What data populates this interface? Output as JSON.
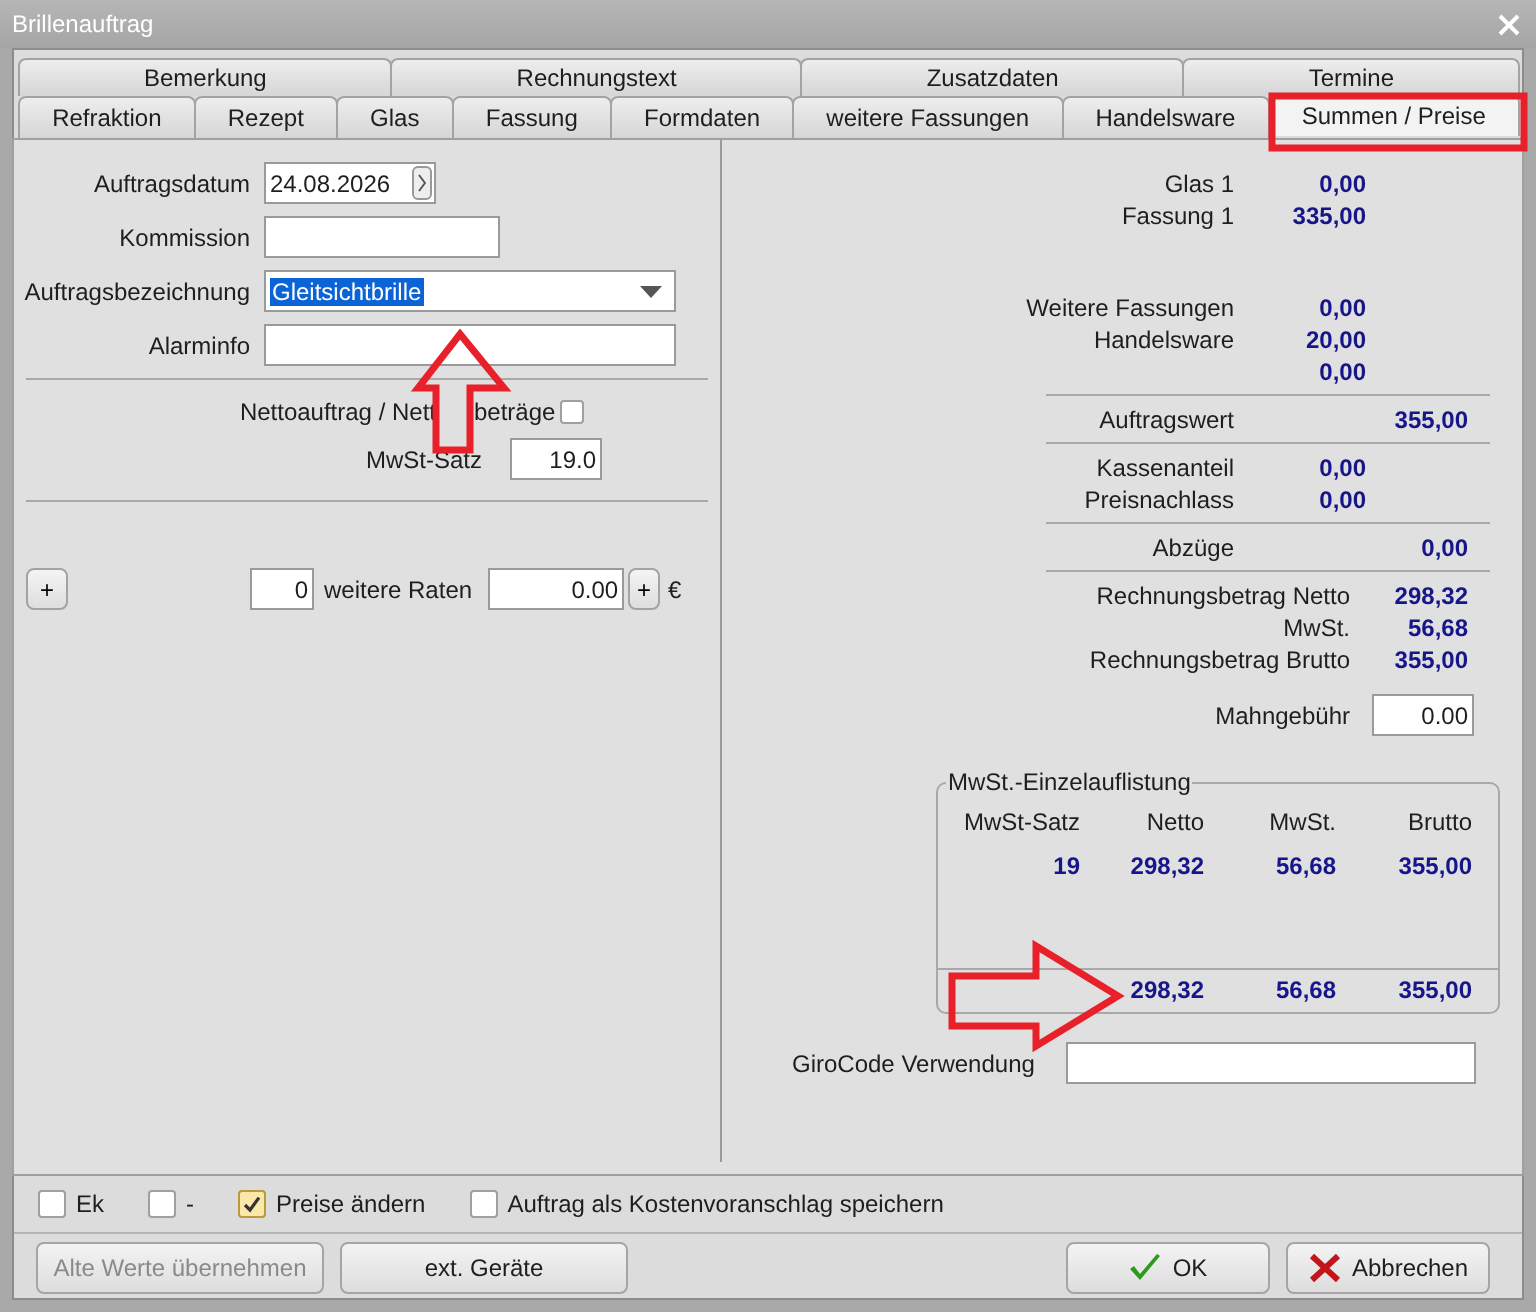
{
  "window": {
    "title": "Brillenauftrag"
  },
  "tabs": {
    "upper": [
      {
        "label": "Bemerkung",
        "selected": false
      },
      {
        "label": "Rechnungstext",
        "selected": false
      },
      {
        "label": "Zusatzdaten",
        "selected": false
      },
      {
        "label": "Termine",
        "selected": false
      }
    ],
    "lower": [
      {
        "label": "Refraktion",
        "selected": false
      },
      {
        "label": "Rezept",
        "selected": false
      },
      {
        "label": "Glas",
        "selected": false
      },
      {
        "label": "Fassung",
        "selected": false
      },
      {
        "label": "Formdaten",
        "selected": false
      },
      {
        "label": "weitere Fassungen",
        "selected": false
      },
      {
        "label": "Handelsware",
        "selected": false
      },
      {
        "label": "Summen / Preise",
        "selected": true
      }
    ]
  },
  "order": {
    "fields": [
      {
        "kind": "date",
        "label": "Auftragsdatum",
        "value": "24.08.2026"
      },
      {
        "kind": "short_text",
        "label": "Kommission"
      },
      {
        "kind": "combo",
        "label": "Auftragsbezeichnung",
        "value": "Gleitsichtbrille",
        "selected": true
      },
      {
        "kind": "text",
        "label": "Alarminfo"
      }
    ],
    "net_order": {
      "label_parts": [
        "Nettoauftrag / Nett",
        "beträge"
      ],
      "checked": false
    },
    "vat_rate": {
      "label": "MwSt-Satz",
      "value": "19.0"
    },
    "installments": {
      "add_button": "+",
      "count": "0",
      "label": "weitere Raten",
      "amount": "0.00",
      "amount_button": "+",
      "currency": "€"
    }
  },
  "summary": {
    "sections": [
      {
        "rows": [
          {
            "kind": "item",
            "label": "Glas 1",
            "value": "0,00"
          },
          {
            "kind": "item",
            "label": "Fassung 1",
            "value": "335,00"
          }
        ]
      },
      {
        "rows": [
          {
            "kind": "item",
            "label": "Weitere Fassungen",
            "value": "0,00"
          },
          {
            "kind": "item",
            "label": "Handelsware",
            "value": "20,00"
          },
          {
            "kind": "item",
            "value": "0,00"
          }
        ]
      },
      {
        "rows": [
          {
            "kind": "total",
            "label": "Auftragswert",
            "value": "355,00"
          }
        ]
      },
      {
        "rows": [
          {
            "kind": "item",
            "label": "Kassenanteil",
            "value": "0,00"
          },
          {
            "kind": "item",
            "label": "Preisnachlass",
            "value": "0,00"
          }
        ]
      },
      {
        "rows": [
          {
            "kind": "total",
            "label": "Abzüge",
            "value": "0,00"
          }
        ]
      },
      {
        "rows": [
          {
            "kind": "result",
            "label": "Rechnungsbetrag Netto",
            "value": "298,32"
          },
          {
            "kind": "result",
            "label": "MwSt.",
            "value": "56,68"
          },
          {
            "kind": "result",
            "label": "Rechnungsbetrag Brutto",
            "value": "355,00"
          }
        ]
      }
    ],
    "reminder_fee": {
      "label": "Mahngebühr",
      "value": "0.00"
    },
    "tax_breakdown": {
      "title": "MwSt.-Einzelauflistung",
      "columns": [
        "MwSt-Satz",
        "Netto",
        "MwSt.",
        "Brutto"
      ],
      "rows": [
        [
          "19",
          "298,32",
          "56,68",
          "355,00"
        ]
      ],
      "totals": [
        "298,32",
        "56,68",
        "355,00"
      ]
    },
    "girocode": {
      "label": "GiroCode Verwendung"
    }
  },
  "options": [
    {
      "label": "Ek",
      "checked": false
    },
    {
      "label": "-",
      "checked": false
    },
    {
      "label": "Preise ändern",
      "checked": true
    },
    {
      "label": "Auftrag als Kostenvoranschlag speichern",
      "checked": false
    }
  ],
  "buttons": [
    {
      "kind": "plain",
      "label": "Alte Werte übernehmen",
      "disabled": true
    },
    {
      "kind": "plain",
      "label": "ext. Geräte",
      "disabled": false
    },
    {
      "kind": "ok",
      "label": "OK",
      "disabled": false
    },
    {
      "kind": "cancel",
      "label": "Abbrechen",
      "disabled": false
    }
  ],
  "annotations": [
    {
      "kind": "frame"
    },
    {
      "kind": "arrow_up"
    },
    {
      "kind": "arrow_right"
    }
  ]
}
